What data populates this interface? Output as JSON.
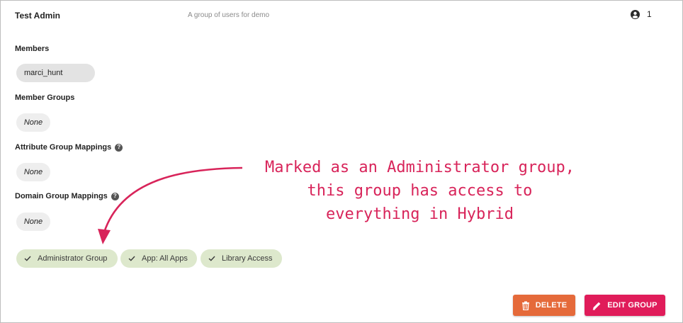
{
  "header": {
    "group_name": "Test Admin",
    "description": "A group of users for demo",
    "member_count": "1",
    "member_count_icon": "user-circle-icon"
  },
  "sections": {
    "members_label": "Members",
    "member_groups_label": "Member Groups",
    "attribute_mappings_label": "Attribute Group Mappings",
    "domain_mappings_label": "Domain Group Mappings",
    "help_glyph": "?"
  },
  "members": [
    "marci_hunt"
  ],
  "member_groups_value": "None",
  "attribute_mappings_value": "None",
  "domain_mappings_value": "None",
  "permissions": [
    {
      "label": "Administrator Group",
      "icon": "check-icon"
    },
    {
      "label": "App: All Apps",
      "icon": "check-icon"
    },
    {
      "label": "Library Access",
      "icon": "check-icon"
    }
  ],
  "annotation": {
    "line1": "Marked as an Administrator group,",
    "line2": "this group has access to",
    "line3": "everything in Hybrid",
    "color": "#d8245a"
  },
  "actions": {
    "delete_label": "DELETE",
    "edit_label": "EDIT GROUP",
    "delete_color": "#e56a3a",
    "edit_color": "#e01c5a"
  },
  "colors": {
    "permission_chip": "#dde8cc",
    "neutral_chip": "#eeeeee",
    "border": "#bdbdbd"
  }
}
